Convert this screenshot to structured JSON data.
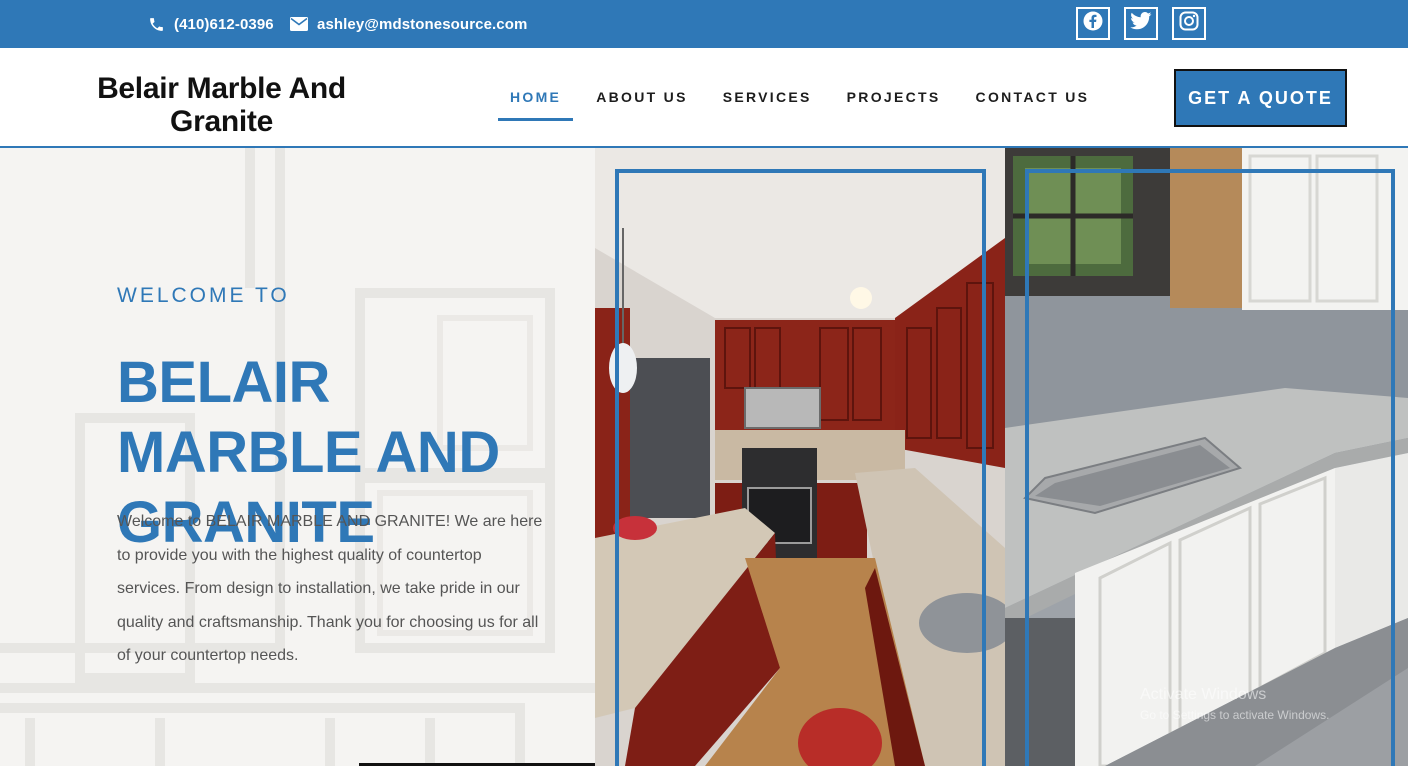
{
  "topbar": {
    "phone": "(410)612-0396",
    "email": "ashley@mdstonesource.com",
    "socials": [
      "facebook-icon",
      "twitter-icon",
      "instagram-icon"
    ]
  },
  "header": {
    "logo": "Belair Marble And Granite",
    "nav": [
      "HOME",
      "ABOUT US",
      "SERVICES",
      "PROJECTS",
      "CONTACT US"
    ],
    "active": "HOME",
    "cta": "GET A QUOTE"
  },
  "hero": {
    "eyebrow": "WELCOME TO",
    "title": "BELAIR MARBLE AND GRANITE",
    "description": "Welcome to BELAIR MARBLE AND GRANITE! We are here to provide you with the highest quality of countertop services. From design to installation, we take pride in our quality and craftsmanship. Thank you for choosing us for all of your countertop needs."
  },
  "overlay": {
    "line1": "Activate Windows",
    "line2": "Go to Settings to activate Windows."
  },
  "colors": {
    "brand": "#2f78b7",
    "dark": "#111111",
    "hero_bg": "#f5f4f2"
  }
}
